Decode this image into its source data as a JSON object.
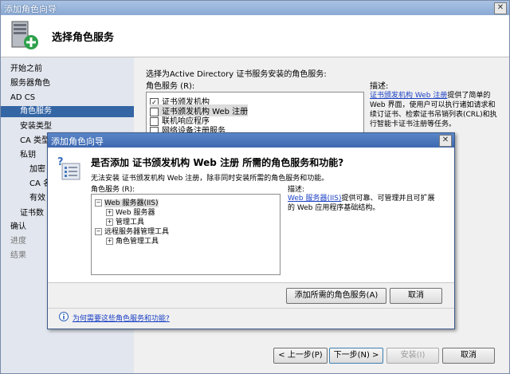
{
  "window": {
    "title": "添加角色向导"
  },
  "header": {
    "title": "选择角色服务"
  },
  "sidebar": {
    "items": [
      {
        "label": "开始之前"
      },
      {
        "label": "服务器角色"
      },
      {
        "label": "AD CS"
      },
      {
        "label": "角色服务"
      },
      {
        "label": "安装类型"
      },
      {
        "label": "CA 类型"
      },
      {
        "label": "私钥"
      },
      {
        "label": "加密"
      },
      {
        "label": "CA 名"
      },
      {
        "label": "有效"
      },
      {
        "label": "证书数"
      },
      {
        "label": "确认"
      },
      {
        "label": "进度"
      },
      {
        "label": "结果"
      }
    ]
  },
  "main": {
    "instruction": "选择为Active Directory 证书服务安装的角色服务:",
    "roles_label": "角色服务 (R):",
    "roles": [
      {
        "label": "证书颁发机构",
        "checked": true
      },
      {
        "label": "证书颁发机构 Web 注册",
        "checked": false
      },
      {
        "label": "联机响应程序",
        "checked": false
      },
      {
        "label": "网络设备注册服务",
        "checked": false
      }
    ],
    "desc_label": "描述:",
    "desc_link": "证书颁发机构 Web 注册",
    "desc_text": "提供了简单的 Web 界面，使用户可以执行诸如请求和续订证书、检索证书吊销列表(CRL)和执行智能卡证书注册等任务。"
  },
  "footer": {
    "prev": "< 上一步(P)",
    "next": "下一步(N) >",
    "install": "安装(I)",
    "cancel": "取消"
  },
  "modal": {
    "title": "添加角色向导",
    "question": "是否添加 证书颁发机构 Web 注册 所需的角色服务和功能?",
    "subtitle": "无法安装 证书颁发机构 Web 注册，除非同时安装所需的角色服务和功能。",
    "roles_label": "角色服务 (R):",
    "tree": [
      {
        "label": "Web 服务器(IIS)"
      },
      {
        "label": "Web 服务器"
      },
      {
        "label": "管理工具"
      },
      {
        "label": "远程服务器管理工具"
      },
      {
        "label": "角色管理工具"
      }
    ],
    "desc_label": "描述:",
    "desc_link": "Web 服务器(IIS)",
    "desc_text": "提供可靠、可管理并且可扩展的 Web 应用程序基础结构。",
    "add_button": "添加所需的角色服务(A)",
    "cancel_button": "取消",
    "help_link": "为何需要这些角色服务和功能?"
  }
}
